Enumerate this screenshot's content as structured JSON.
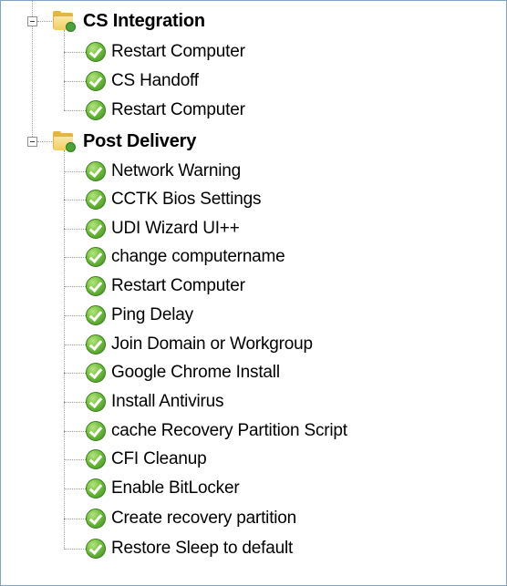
{
  "tree": {
    "groups": [
      {
        "name": "CS Integration",
        "icon": "folder-success-icon",
        "expanded": true,
        "items": [
          {
            "label": "Restart Computer",
            "icon": "success-check-icon"
          },
          {
            "label": "CS Handoff",
            "icon": "success-check-icon"
          },
          {
            "label": "Restart Computer",
            "icon": "success-check-icon"
          }
        ]
      },
      {
        "name": "Post Delivery",
        "icon": "folder-success-icon",
        "expanded": true,
        "items": [
          {
            "label": "Network Warning",
            "icon": "success-check-icon"
          },
          {
            "label": "CCTK Bios Settings",
            "icon": "success-check-icon"
          },
          {
            "label": "UDI Wizard UI++",
            "icon": "success-check-icon"
          },
          {
            "label": "change computername",
            "icon": "success-check-icon"
          },
          {
            "label": "Restart Computer",
            "icon": "success-check-icon"
          },
          {
            "label": "Ping Delay",
            "icon": "success-check-icon"
          },
          {
            "label": "Join Domain or Workgroup",
            "icon": "success-check-icon"
          },
          {
            "label": "Google Chrome Install",
            "icon": "success-check-icon"
          },
          {
            "label": "Install Antivirus",
            "icon": "success-check-icon"
          },
          {
            "label": "cache Recovery Partition Script",
            "icon": "success-check-icon"
          },
          {
            "label": "CFI Cleanup",
            "icon": "success-check-icon"
          },
          {
            "label": "Enable BitLocker",
            "icon": "success-check-icon"
          },
          {
            "label": "Create recovery partition",
            "icon": "success-check-icon"
          },
          {
            "label": "Restore Sleep to default",
            "icon": "success-check-icon"
          }
        ]
      }
    ],
    "colors": {
      "border": "#7ea3c4",
      "check_green": "#6fbf3b",
      "folder_yellow": "#e3b542"
    }
  }
}
